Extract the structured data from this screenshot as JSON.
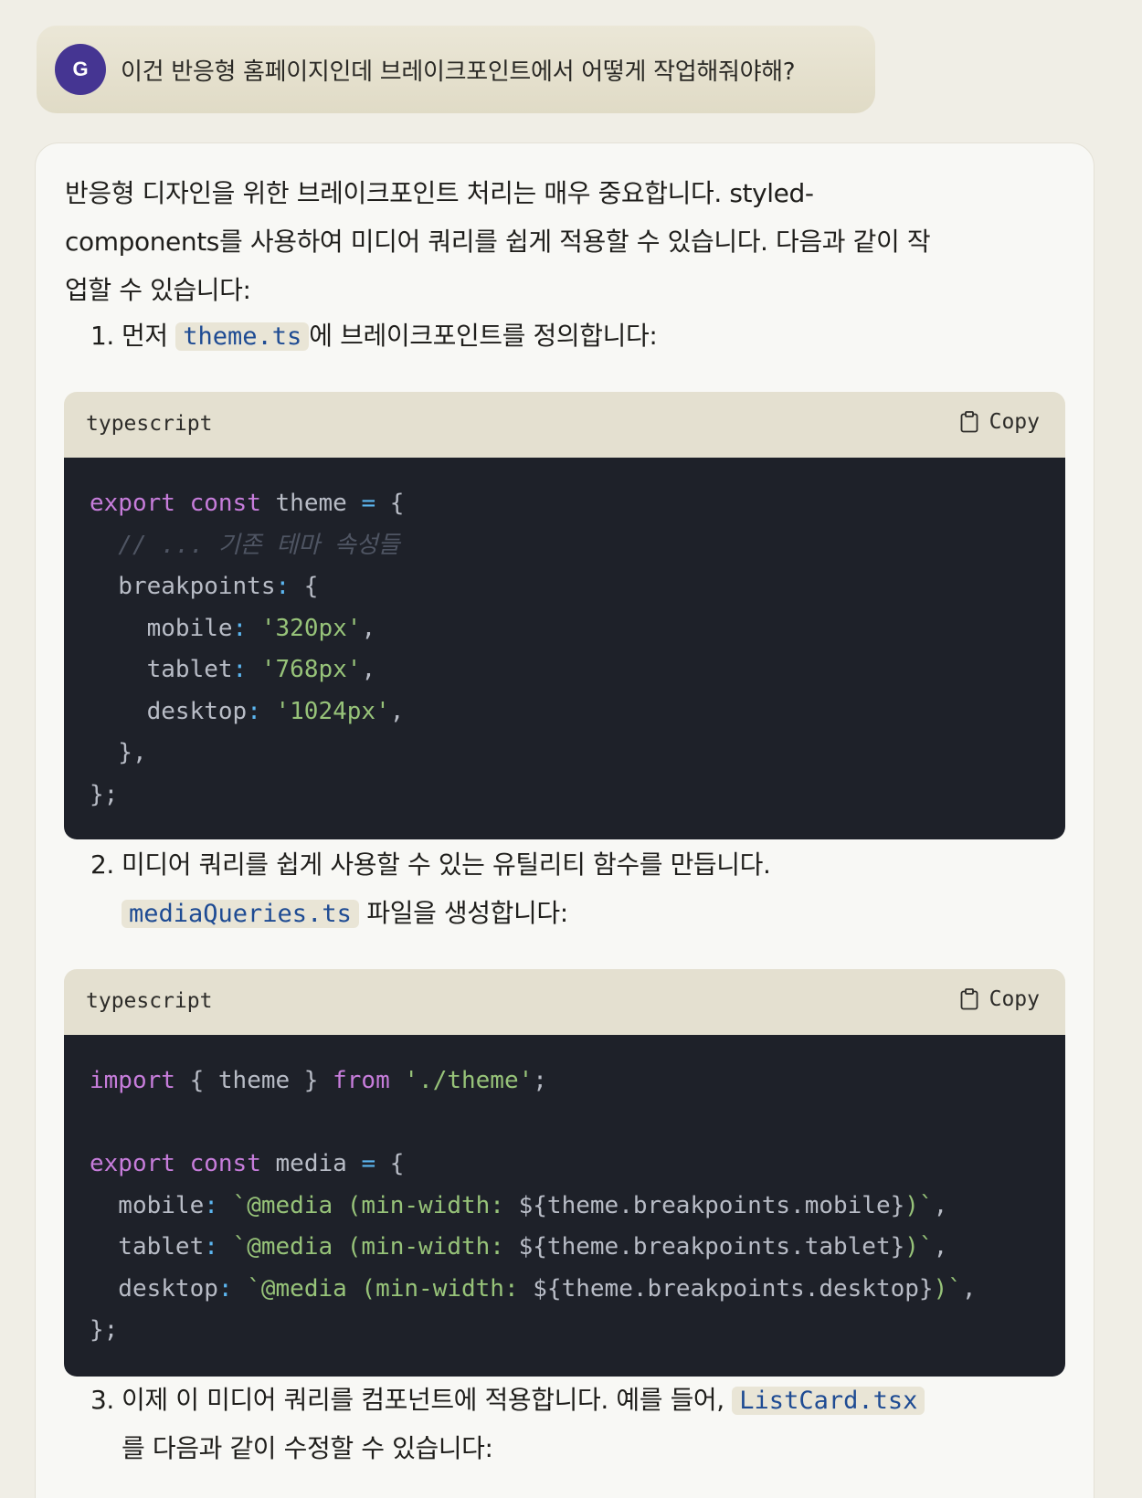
{
  "user_message": {
    "avatar_initial": "G",
    "text": "이건 반응형 홈페이지인데 브레이크포인트에서 어떻게 작업해줘야해?"
  },
  "reply": {
    "intro_line1": "반응형 디자인을 위한 브레이크포인트 처리는 매우 중요합니다. styled-",
    "intro_line2": "components를 사용하여 미디어 쿼리를 쉽게 적용할 수 있습니다. 다음과 같이 작",
    "intro_line3": "업할 수 있습니다:",
    "steps": [
      {
        "num": "1.",
        "before": "먼저 ",
        "code": "theme.ts",
        "after": "에 브레이크포인트를 정의합니다:"
      },
      {
        "num": "2.",
        "line1": "미디어 쿼리를 쉽게 사용할 수 있는 유틸리티 함수를 만듭니다.",
        "code": "mediaQueries.ts",
        "after": " 파일을 생성합니다:"
      },
      {
        "num": "3.",
        "before": "이제 이 미디어 쿼리를 컴포넌트에 적용합니다. 예를 들어, ",
        "code": "ListCard.tsx",
        "line2": "를 다음과 같이 수정할 수 있습니다:"
      }
    ],
    "code_blocks": [
      {
        "language": "typescript",
        "copy_label": "Copy",
        "lines": {
          "l1_kw1": "export",
          "l1_kw2": "const",
          "l1_name": " theme ",
          "l1_op": "=",
          "l1_rest": " {",
          "l2_comment": "  // ... 기존 테마 속성들",
          "l3_key": "  breakpoints",
          "l3_op": ":",
          "l3_rest": " {",
          "l4_key": "    mobile",
          "l4_op": ":",
          "l4_str": "'320px'",
          "l4_rest": ",",
          "l5_key": "    tablet",
          "l5_op": ":",
          "l5_str": "'768px'",
          "l5_rest": ",",
          "l6_key": "    desktop",
          "l6_op": ":",
          "l6_str": "'1024px'",
          "l6_rest": ",",
          "l7": "  },",
          "l8": "};"
        }
      },
      {
        "language": "typescript",
        "copy_label": "Copy",
        "lines": {
          "l1_kw1": "import",
          "l1_mid": " { theme } ",
          "l1_kw2": "from",
          "l1_str": "'./theme'",
          "l1_rest": ";",
          "l3_kw1": "export",
          "l3_kw2": "const",
          "l3_name": " media ",
          "l3_op": "=",
          "l3_rest": " {",
          "l4_key": "  mobile",
          "l4_op": ":",
          "l4_str1": "`@media (min-width: ",
          "l4_expr": "${theme.breakpoints.mobile}",
          "l4_str2": ")`",
          "l4_rest": ",",
          "l5_key": "  tablet",
          "l5_op": ":",
          "l5_str1": "`@media (min-width: ",
          "l5_expr": "${theme.breakpoints.tablet}",
          "l5_str2": ")`",
          "l5_rest": ",",
          "l6_key": "  desktop",
          "l6_op": ":",
          "l6_str1": "`@media (min-width: ",
          "l6_expr": "${theme.breakpoints.desktop}",
          "l6_str2": ")`",
          "l6_rest": ",",
          "l7": "};"
        }
      }
    ]
  }
}
